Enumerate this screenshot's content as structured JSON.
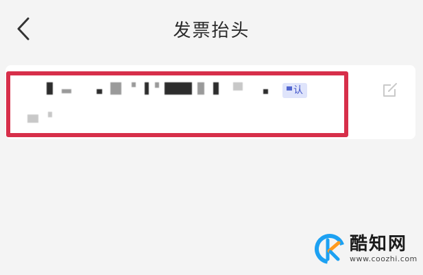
{
  "header": {
    "back_icon": "chevron-left-icon",
    "title": "发票抬头"
  },
  "invoice_card": {
    "default_badge_text": "认",
    "edit_icon": "edit-icon",
    "highlight_color": "#d72f4a"
  },
  "watermark": {
    "name": "酷知网",
    "url": "www.coozhi.com",
    "logo_colors": [
      "#1da1f2",
      "#ff9a1e"
    ]
  }
}
